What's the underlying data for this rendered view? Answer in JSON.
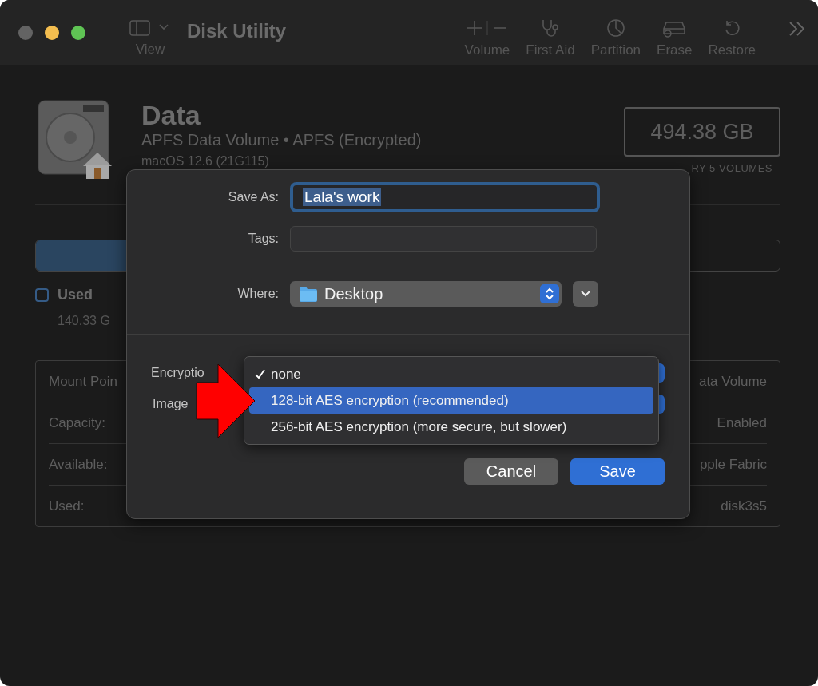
{
  "window": {
    "title": "Disk Utility"
  },
  "toolbar": {
    "view": {
      "label": "View"
    },
    "items": [
      {
        "kind": "volume",
        "label": "Volume"
      },
      {
        "kind": "firstaid",
        "label": "First Aid"
      },
      {
        "kind": "partition",
        "label": "Partition"
      },
      {
        "kind": "erase",
        "label": "Erase"
      },
      {
        "kind": "restore",
        "label": "Restore"
      }
    ]
  },
  "volume": {
    "name": "Data",
    "subtitle": "APFS Data Volume • APFS (Encrypted)",
    "os": "macOS 12.6 (21G115)",
    "capacity": "494.38 GB",
    "shared": "RY 5 VOLUMES"
  },
  "usage": {
    "level": 0.28,
    "legend": {
      "label": "Used",
      "value": "140.33 G"
    }
  },
  "info": [
    {
      "left": "Mount Poin",
      "right": "ata Volume"
    },
    {
      "left": "Capacity:",
      "right": "Enabled"
    },
    {
      "left": "Available:",
      "right": "pple Fabric"
    },
    {
      "left": "Used:",
      "right": "disk3s5"
    }
  ],
  "dialog": {
    "save_as": {
      "label": "Save As:",
      "value": "Lala's work"
    },
    "tags": {
      "label": "Tags:"
    },
    "where": {
      "label": "Where:",
      "value": "Desktop"
    },
    "encryption": {
      "label": "Encryptio"
    },
    "image": {
      "label": "Image"
    },
    "menu": [
      {
        "label": "none",
        "checked": true,
        "selected": false
      },
      {
        "label": "128-bit AES encryption (recommended)",
        "checked": false,
        "selected": true
      },
      {
        "label": "256-bit AES encryption (more secure, but slower)",
        "checked": false,
        "selected": false
      }
    ],
    "buttons": [
      {
        "label": "Cancel",
        "kind": "normal"
      },
      {
        "label": "Save",
        "kind": "default"
      }
    ]
  }
}
